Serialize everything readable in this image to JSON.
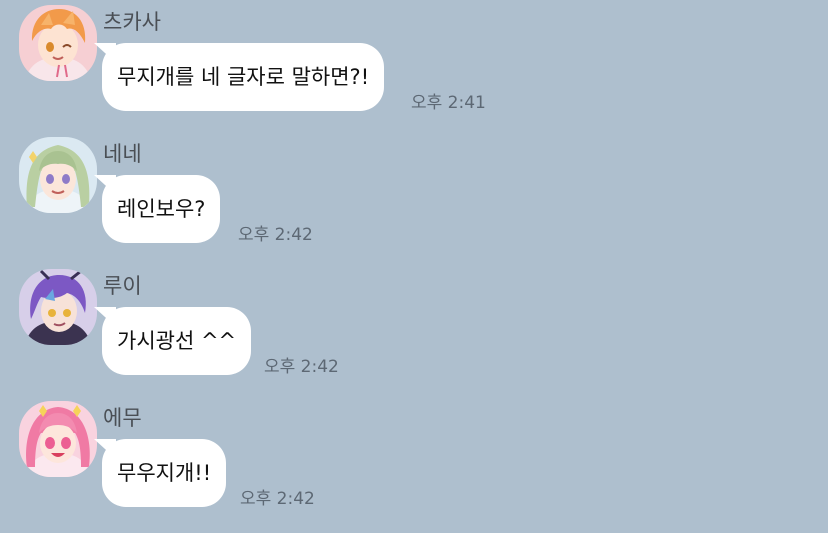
{
  "messages": [
    {
      "sender": "츠카사",
      "text": "무지개를 네 글자로 말하면?!",
      "time": "오후 2:41",
      "avatar_icon": "tsukasa-avatar-icon",
      "avatar_colors": {
        "bg": "#f6cfd3",
        "hair": "#f29a4a",
        "eye": "#d98a2c"
      }
    },
    {
      "sender": "네네",
      "text": "레인보우?",
      "time": "오후 2:42",
      "avatar_icon": "nene-avatar-icon",
      "avatar_colors": {
        "bg": "#dbe9f2",
        "hair": "#b9cfa2",
        "eye": "#8e7bc8"
      }
    },
    {
      "sender": "루이",
      "text": "가시광선 ^^",
      "time": "오후 2:42",
      "avatar_icon": "rui-avatar-icon",
      "avatar_colors": {
        "bg": "#d7cfe9",
        "hair": "#7c58c4",
        "eye": "#e8b33a"
      }
    },
    {
      "sender": "에무",
      "text": "무우지개!!",
      "time": "오후 2:42",
      "avatar_icon": "emu-avatar-icon",
      "avatar_colors": {
        "bg": "#f9d3df",
        "hair": "#f07aa4",
        "eye": "#ec5f93"
      }
    }
  ]
}
